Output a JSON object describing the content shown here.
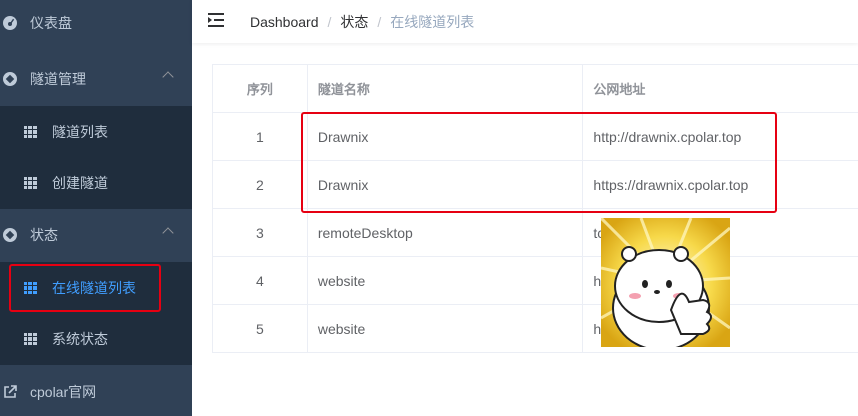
{
  "sidebar": {
    "items": [
      {
        "label": "仪表盘"
      },
      {
        "label": "隧道管理"
      },
      {
        "label": "隧道列表"
      },
      {
        "label": "创建隧道"
      },
      {
        "label": "状态"
      },
      {
        "label": "在线隧道列表"
      },
      {
        "label": "系统状态"
      },
      {
        "label": "cpolar官网"
      }
    ]
  },
  "header": {
    "breadcrumb": [
      "Dashboard",
      "状态",
      "在线隧道列表"
    ]
  },
  "table": {
    "columns": [
      "序列",
      "隧道名称",
      "公网地址"
    ],
    "rows": [
      [
        "1",
        "Drawnix",
        "http://drawnix.cpolar.top"
      ],
      [
        "2",
        "Drawnix",
        "https://drawnix.cpolar.top"
      ],
      [
        "3",
        "remoteDesktop",
        "tcp://.cpolar.cn:10058"
      ],
      [
        "4",
        "website",
        "http://s.cpolar.cn"
      ],
      [
        "5",
        "website",
        "https://as.cpolar.cn"
      ]
    ]
  },
  "colors": {
    "sidebar_bg": "#304156",
    "submenu_bg": "#1f2d3d",
    "active": "#409eff",
    "highlight_box": "#e60012"
  }
}
